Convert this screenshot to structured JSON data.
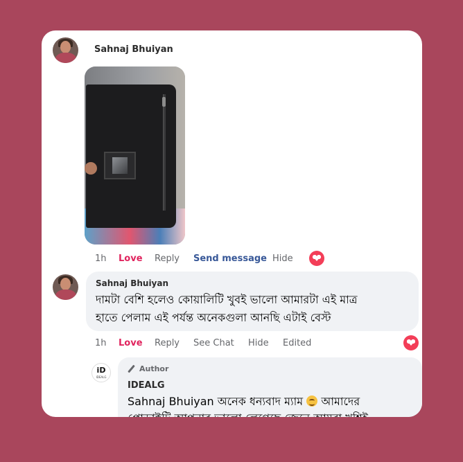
{
  "post": {
    "author": "Sahnaj Bhuiyan",
    "time": "1h",
    "actions": [
      "Love",
      "Reply",
      "Send message",
      "Hide"
    ],
    "reaction_icon": "love-heart-icon"
  },
  "comment": {
    "author": "Sahnaj Bhuiyan",
    "line1": "দামটা বেশি হলেও কোয়ালিটি খুবই ভালো আমারটা এই মাত্র",
    "line2": "হাতে পেলাম এই পর্যন্ত অনেকগুলা আনছি এটাই বেস্ট",
    "time": "1h",
    "actions": [
      "Love",
      "Reply",
      "See Chat",
      "Hide",
      "Edited"
    ],
    "reaction_icon": "love-heart-icon"
  },
  "reply": {
    "badge": "Author",
    "author": "IDEALG",
    "logo_mark": "iD",
    "logo_sub": "IDEALG",
    "tag": "Sahnaj Bhuiyan",
    "text_a": " অনেক ধন্যবাদ ম্যাম ",
    "text_b": " আমাদের",
    "text_c": "প্রোডাক্টটি আপনার ভালো লেগেছে জেনে আমরা খুশিই"
  },
  "colors": {
    "background": "#a9465c",
    "love": "#e0245e",
    "link": "#385898",
    "bubble": "#f0f2f5"
  }
}
